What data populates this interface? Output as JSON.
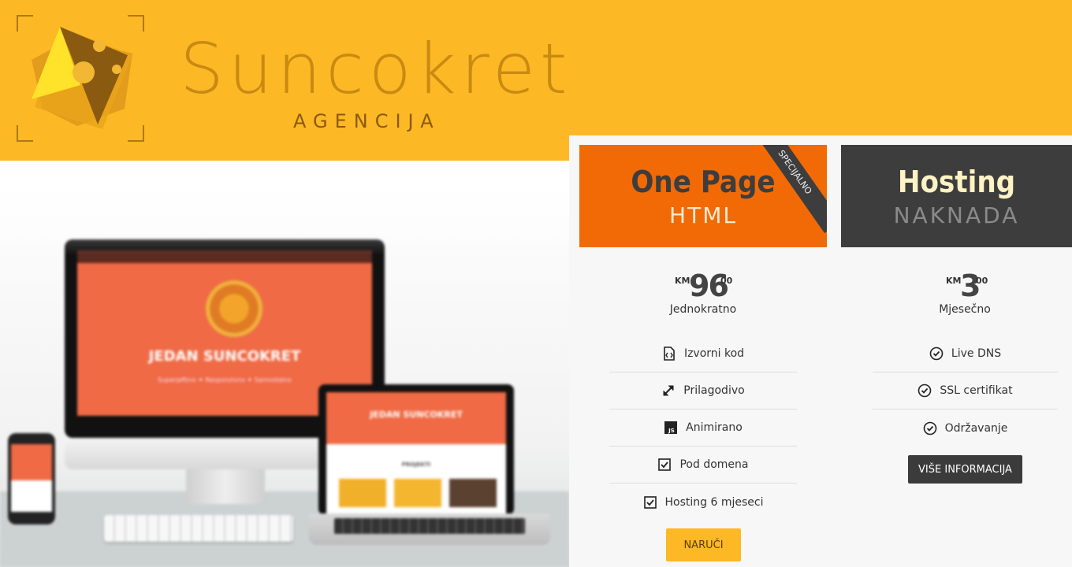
{
  "brand": {
    "name": "Suncokret",
    "subtitle": "agencija"
  },
  "hero": {
    "desktop_title": "JEDAN SUNCOKRET",
    "desktop_subtitle": "Superjeftino ✦ Responzivno ✦ Samostalno",
    "laptop_title": "JEDAN SUNCOKRET",
    "laptop_section": "PROJEKTI"
  },
  "plans": [
    {
      "title": "One Page",
      "subtitle": "HTML",
      "ribbon": "SPECIJALNO",
      "currency": "KM",
      "price": "96",
      "cents": "00",
      "period": "Jednokratno",
      "features": [
        {
          "icon": "file-code-icon",
          "label": "Izvorni kod"
        },
        {
          "icon": "expand-arrows-icon",
          "label": "Prilagodivo"
        },
        {
          "icon": "javascript-icon",
          "label": "Animirano"
        },
        {
          "icon": "checkbox-checked-icon",
          "label": "Pod domena"
        },
        {
          "icon": "checkbox-checked-icon",
          "label": "Hosting 6 mjeseci"
        }
      ],
      "button": "NARUČI"
    },
    {
      "title": "Hosting",
      "subtitle": "NAKNADA",
      "currency": "KM",
      "price": "3",
      "cents": "00",
      "period": "Mjesečno",
      "features": [
        {
          "icon": "check-circle-icon",
          "label": "Live DNS"
        },
        {
          "icon": "check-circle-icon",
          "label": "SSL certifikat"
        },
        {
          "icon": "check-circle-icon",
          "label": "Održavanje"
        }
      ],
      "button": "VIŠE INFORMACIJA"
    }
  ],
  "colors": {
    "header_yellow": "#fdb825",
    "plan_orange": "#f26a05",
    "plan_dark": "#3d3d3d",
    "order_button": "#fdb825",
    "info_button": "#3b3b3b"
  }
}
